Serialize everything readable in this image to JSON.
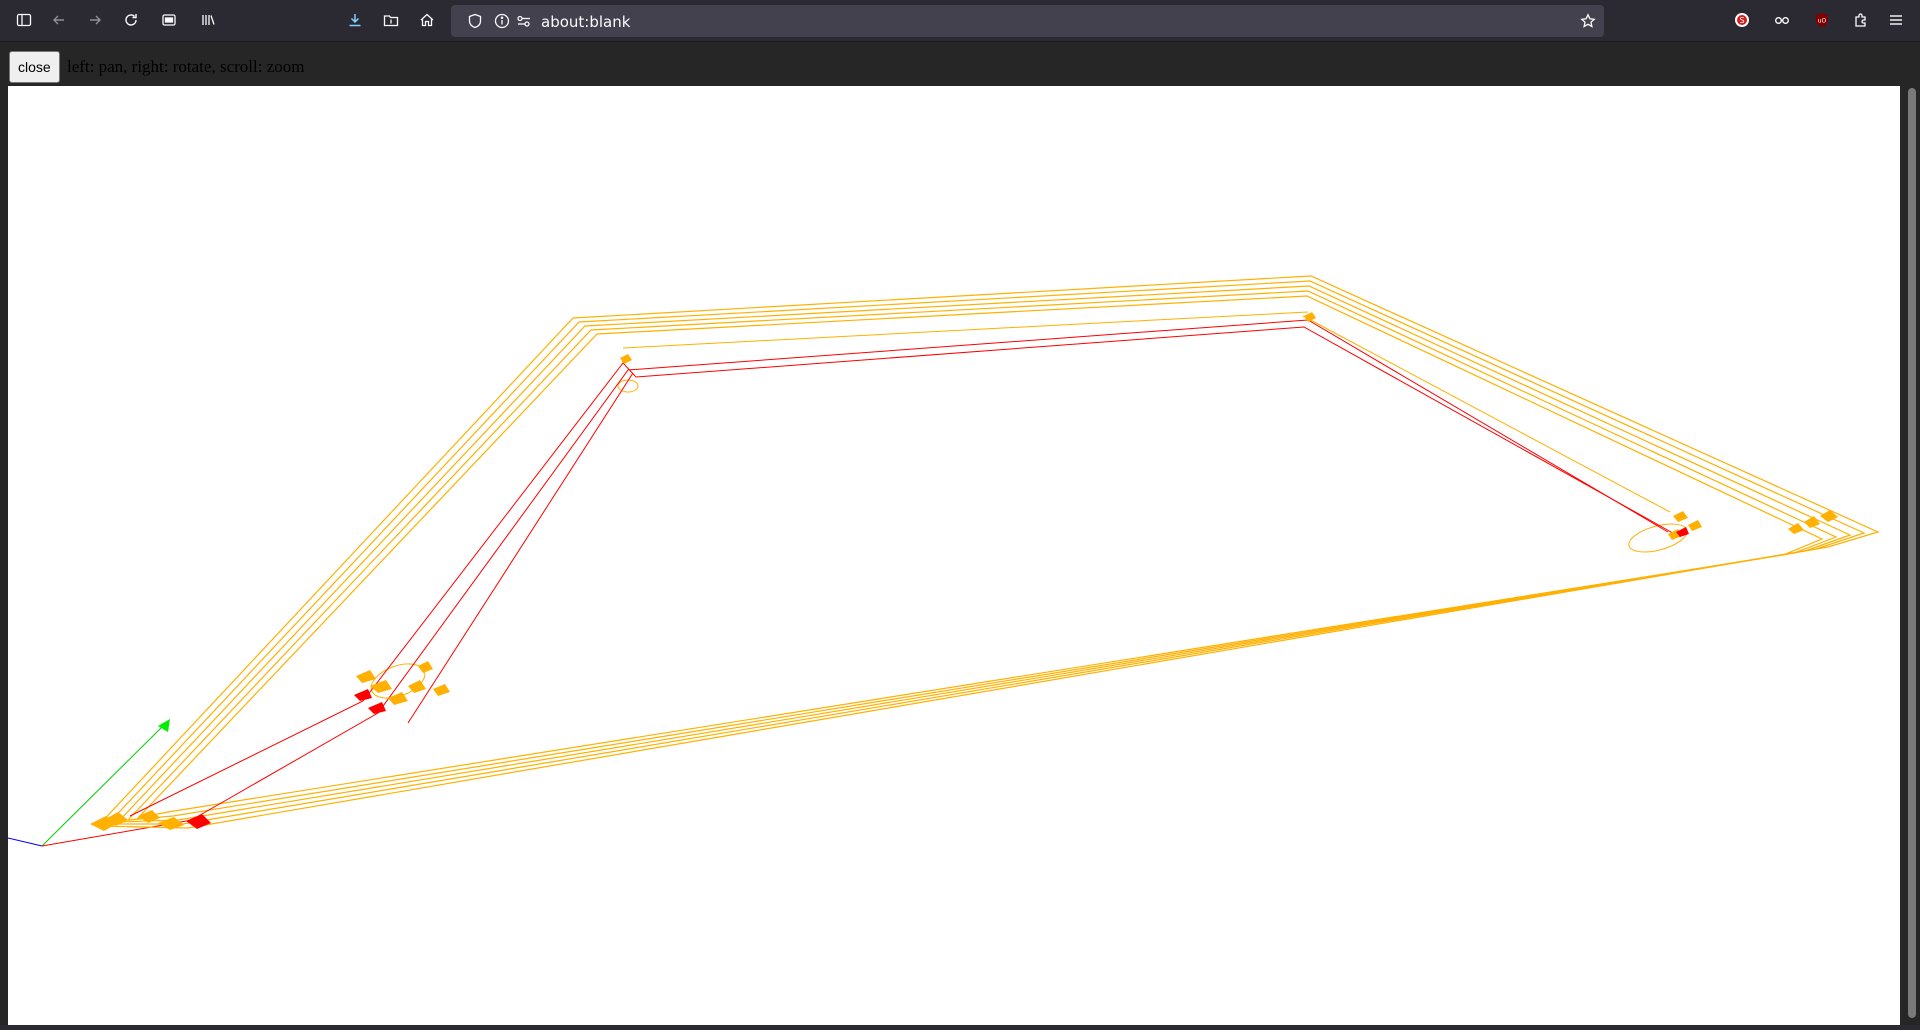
{
  "browser": {
    "url": "about:blank",
    "toolbar_icons": [
      "sidebar-icon",
      "back-icon",
      "forward-icon",
      "reload-icon",
      "pocket-icon",
      "library-icon",
      "download-icon",
      "folder-icon",
      "home-icon"
    ],
    "extensions": [
      "extension-s-icon",
      "extension-glasses-icon",
      "ublock-icon",
      "extensions-puzzle-icon",
      "menu-icon"
    ]
  },
  "viewer": {
    "close_label": "close",
    "hint": "left: pan, right: rotate, scroll: zoom"
  },
  "colors": {
    "path": "#ffb000",
    "travel": "#ff0000",
    "axis_x": "#ff0000",
    "axis_y": "#00cc00",
    "axis_z": "#0000ff"
  }
}
